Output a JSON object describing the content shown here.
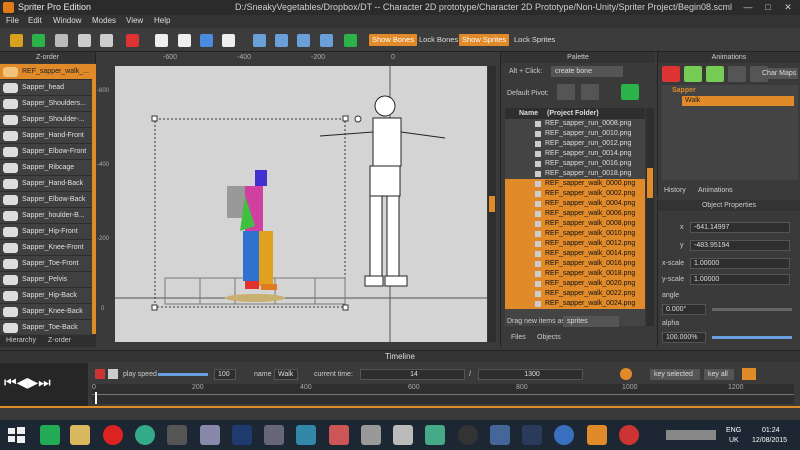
{
  "window": {
    "app_title": "Spriter Pro Edition",
    "file_path": "D:/SneakyVegetables/Dropbox/DT -- Character 2D prototype/Character 2D Prototype/Non-Unity/Spriter Project/Begin08.scml",
    "min_label": "—",
    "max_label": "□",
    "close_label": "✕"
  },
  "menu": [
    "File",
    "Edit",
    "Window",
    "Modes",
    "View",
    "Help"
  ],
  "toolbar": {
    "show_bones": "Show Bones",
    "lock_bones": "Lock Bones",
    "show_sprites": "Show Sprites",
    "lock_sprites": "Lock Sprites"
  },
  "zorder": {
    "title": "Z-order",
    "items": [
      "REF_sapper_walk_...",
      "Sapper_head",
      "Sapper_Shoulders...",
      "Sapper_Shoulder-...",
      "Sapper_Hand-Front",
      "Sapper_Elbow-Front",
      "Sapper_Ribcage",
      "Sapper_Hand-Back",
      "Sapper_Elbow-Back",
      "Sapper_houlder-B...",
      "Sapper_Hip-Front",
      "Sapper_Knee-Front",
      "Sapper_Toe-Front",
      "Sapper_Pelvis",
      "Sapper_Hip-Back",
      "Sapper_Knee-Back",
      "Sapper_Toe-Back"
    ],
    "tabs": [
      "Hierarchy",
      "Z-order"
    ]
  },
  "canvas": {
    "ruler_top": [
      "-600",
      "-400",
      "-200",
      "0"
    ],
    "ruler_left": [
      "-600",
      "-400",
      "-200",
      "0"
    ]
  },
  "palette": {
    "title": "Palette",
    "alt_click_label": "Alt + Click:",
    "alt_click_value": "create bone",
    "default_pivot_label": "Default Pivot:",
    "col_name": "Name",
    "col_folder": "(Project Folder)",
    "files": [
      {
        "name": "REF_sapper_run_0008.png",
        "sel": false
      },
      {
        "name": "REF_sapper_run_0010.png",
        "sel": false
      },
      {
        "name": "REF_sapper_run_0012.png",
        "sel": false
      },
      {
        "name": "REF_sapper_run_0014.png",
        "sel": false
      },
      {
        "name": "REF_sapper_run_0016.png",
        "sel": false
      },
      {
        "name": "REF_sapper_run_0018.png",
        "sel": false
      },
      {
        "name": "REF_sapper_walk_0000.png",
        "sel": true
      },
      {
        "name": "REF_sapper_walk_0002.png",
        "sel": true
      },
      {
        "name": "REF_sapper_walk_0004.png",
        "sel": true
      },
      {
        "name": "REF_sapper_walk_0006.png",
        "sel": true
      },
      {
        "name": "REF_sapper_walk_0008.png",
        "sel": true
      },
      {
        "name": "REF_sapper_walk_0010.png",
        "sel": true
      },
      {
        "name": "REF_sapper_walk_0012.png",
        "sel": true
      },
      {
        "name": "REF_sapper_walk_0014.png",
        "sel": true
      },
      {
        "name": "REF_sapper_walk_0016.png",
        "sel": true
      },
      {
        "name": "REF_sapper_walk_0018.png",
        "sel": true
      },
      {
        "name": "REF_sapper_walk_0020.png",
        "sel": true
      },
      {
        "name": "REF_sapper_walk_0022.png",
        "sel": true
      },
      {
        "name": "REF_sapper_walk_0024.png",
        "sel": true
      }
    ],
    "drag_label": "Drag new items as",
    "drag_value": "sprites",
    "tabs": [
      "Files",
      "Objects"
    ]
  },
  "animations": {
    "title": "Animations",
    "char_maps": "Char Maps",
    "entity": "Sapper",
    "anim": "Walk",
    "tabs": [
      "History",
      "Animations"
    ]
  },
  "properties": {
    "title": "Object Properties",
    "x_label": "x",
    "x_value": "-641.14997",
    "y_label": "y",
    "y_value": "-483.95194",
    "xscale_label": "x-scale",
    "xscale_value": "1.00000",
    "yscale_label": "y-scale",
    "yscale_value": "1.00000",
    "angle_label": "angle",
    "angle_value": "0.000°",
    "alpha_label": "alpha",
    "alpha_value": "100.000%"
  },
  "timeline": {
    "title": "Timeline",
    "play_speed_label": "play speed",
    "play_speed_value": "100",
    "name_label": "name",
    "name_value": "Walk",
    "current_time_label": "current time:",
    "current_time_value": "14",
    "separator": "/",
    "total_time_value": "1300",
    "key_selected": "key selected",
    "key_all": "key all",
    "ticks": [
      "0",
      "200",
      "400",
      "600",
      "800",
      "1000",
      "1200"
    ]
  },
  "taskbar": {
    "lang_top": "ENG",
    "lang_bottom": "UK",
    "time": "01:24",
    "date": "12/08/2015"
  },
  "colors": {
    "accent": "#e08a2a",
    "panel": "#3a3a3a",
    "stage": "#d4d4d4"
  }
}
